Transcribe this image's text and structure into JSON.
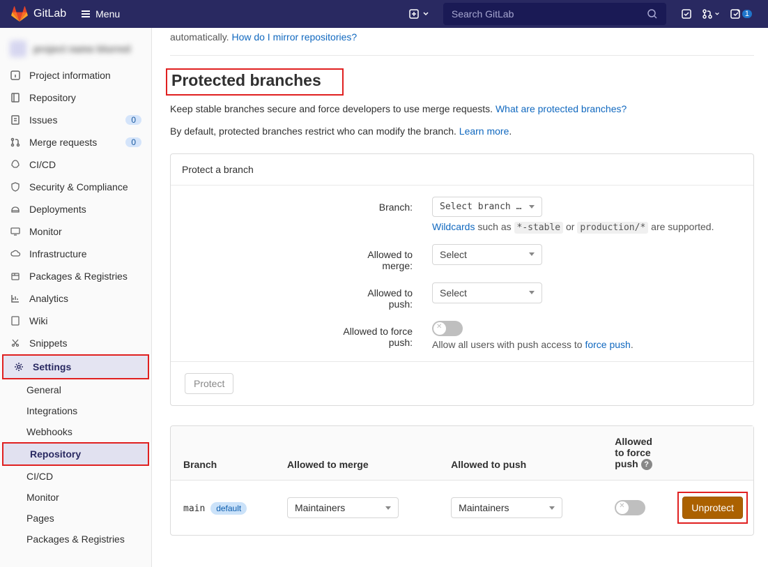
{
  "header": {
    "brand": "GitLab",
    "menu": "Menu",
    "search_placeholder": "Search GitLab",
    "todo_count": "1"
  },
  "sidebar": {
    "items": [
      {
        "label": "Project information"
      },
      {
        "label": "Repository"
      },
      {
        "label": "Issues",
        "badge": "0"
      },
      {
        "label": "Merge requests",
        "badge": "0"
      },
      {
        "label": "CI/CD"
      },
      {
        "label": "Security & Compliance"
      },
      {
        "label": "Deployments"
      },
      {
        "label": "Monitor"
      },
      {
        "label": "Infrastructure"
      },
      {
        "label": "Packages & Registries"
      },
      {
        "label": "Analytics"
      },
      {
        "label": "Wiki"
      },
      {
        "label": "Snippets"
      },
      {
        "label": "Settings"
      }
    ],
    "sub": {
      "general": "General",
      "integrations": "Integrations",
      "webhooks": "Webhooks",
      "repository": "Repository",
      "cicd": "CI/CD",
      "monitor": "Monitor",
      "pages": "Pages",
      "packages": "Packages & Registries"
    }
  },
  "main": {
    "truncated_pre": "automatically. ",
    "truncated_link": "How do I mirror repositories?",
    "title": "Protected branches",
    "desc1_pre": "Keep stable branches secure and force developers to use merge requests. ",
    "desc1_link": "What are protected branches?",
    "desc2_pre": "By default, protected branches restrict who can modify the branch. ",
    "desc2_link": "Learn more",
    "desc2_post": ".",
    "panel_header": "Protect a branch",
    "form": {
      "branch_label": "Branch:",
      "branch_select": "Select branch or create wildcard",
      "wildcards_link": "Wildcards",
      "wildcards_mid": " such as ",
      "code1": "*-stable",
      "or": " or ",
      "code2": "production/*",
      "wildcards_post": " are supported.",
      "merge_label": "Allowed to merge:",
      "merge_select": "Select",
      "push_label": "Allowed to push:",
      "push_select": "Select",
      "force_label": "Allowed to force push:",
      "force_hint_pre": "Allow all users with push access to ",
      "force_link": "force push",
      "force_hint_post": "."
    },
    "protect_btn": "Protect",
    "table": {
      "h_branch": "Branch",
      "h_merge": "Allowed to merge",
      "h_push": "Allowed to push",
      "h_force": "Allowed to force push",
      "row": {
        "branch": "main",
        "badge": "default",
        "merge": "Maintainers",
        "push": "Maintainers",
        "unprotect": "Unprotect"
      }
    }
  }
}
